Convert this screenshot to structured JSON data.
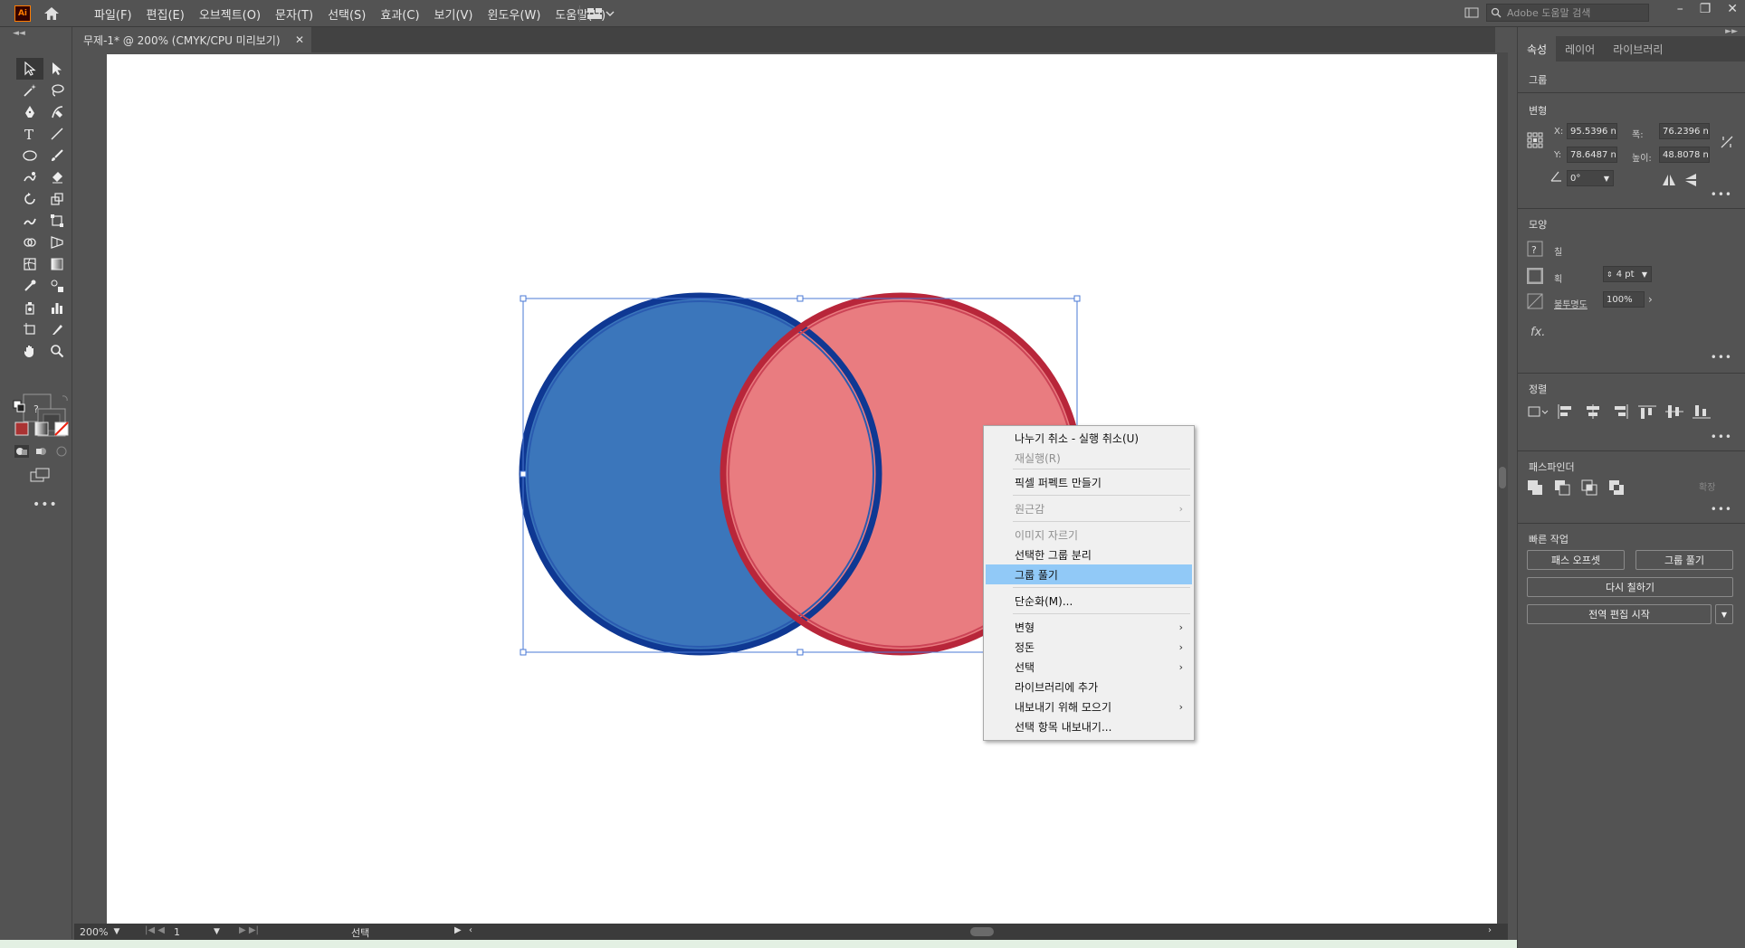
{
  "app": {
    "logo": "Ai",
    "menus": [
      "파일(F)",
      "편집(E)",
      "오브젝트(O)",
      "문자(T)",
      "선택(S)",
      "효과(C)",
      "보기(V)",
      "윈도우(W)",
      "도움말(H)"
    ],
    "search_placeholder": "Adobe 도움말 검색"
  },
  "document": {
    "tab_title": "무제-1* @ 200% (CMYK/CPU 미리보기)",
    "zoom": "200%",
    "page": "1",
    "current_tool": "선택"
  },
  "artwork": {
    "left_circle_fill": "#3b76bb",
    "left_circle_stroke": "#0f3893",
    "right_circle_fill": "#e97c80",
    "right_circle_stroke": "#b8263a",
    "selection_color": "#4a78d6"
  },
  "context_menu": {
    "items": [
      {
        "label": "나누기 취소 - 실행 취소(U)",
        "disabled": false,
        "submenu": false
      },
      {
        "label": "재실행(R)",
        "disabled": true,
        "submenu": false
      },
      {
        "label": "픽셀 퍼펙트 만들기",
        "disabled": false,
        "submenu": false
      },
      {
        "label": "원근감",
        "disabled": true,
        "submenu": true
      },
      {
        "label": "이미지 자르기",
        "disabled": true,
        "submenu": false
      },
      {
        "label": "선택한 그룹 분리",
        "disabled": false,
        "submenu": false
      },
      {
        "label": "그룹 풀기",
        "disabled": false,
        "submenu": false,
        "highlighted": true
      },
      {
        "label": "단순화(M)...",
        "disabled": false,
        "submenu": false
      },
      {
        "label": "변형",
        "disabled": false,
        "submenu": true
      },
      {
        "label": "정돈",
        "disabled": false,
        "submenu": true
      },
      {
        "label": "선택",
        "disabled": false,
        "submenu": true
      },
      {
        "label": "라이브러리에 추가",
        "disabled": false,
        "submenu": false
      },
      {
        "label": "내보내기 위해 모으기",
        "disabled": false,
        "submenu": true
      },
      {
        "label": "선택 항목 내보내기...",
        "disabled": false,
        "submenu": false
      }
    ]
  },
  "properties": {
    "tabs": [
      "속성",
      "레이어",
      "라이브러리"
    ],
    "selection_type": "그룹",
    "transform": {
      "label": "변형",
      "x_label": "X:",
      "x": "95.5396 n",
      "y_label": "Y:",
      "y": "78.6487 n",
      "w_label": "폭:",
      "w": "76.2396 n",
      "h_label": "높이:",
      "h": "48.8078 n",
      "angle": "0°"
    },
    "appearance": {
      "label": "모양",
      "fill_label": "칠",
      "stroke_label": "획",
      "stroke_weight": "4 pt",
      "opacity_label": "불투명도",
      "opacity": "100%",
      "fx": "fx."
    },
    "align": {
      "label": "정렬"
    },
    "pathfinder": {
      "label": "패스파인더",
      "expand": "확장"
    },
    "quick_actions": {
      "label": "빠른 작업",
      "offset_path": "패스 오프셋",
      "ungroup": "그룹 풀기",
      "recolor": "다시 칠하기",
      "global_edit": "전역 편집 시작"
    }
  }
}
